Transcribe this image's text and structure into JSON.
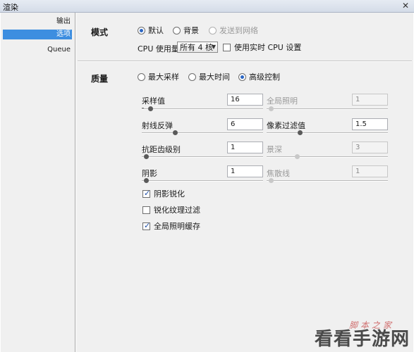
{
  "window": {
    "title": "渲染",
    "close_glyph": "✕"
  },
  "sidebar": {
    "items": [
      {
        "label": "输出",
        "selected": false
      },
      {
        "label": "选项",
        "selected": true
      },
      {
        "label": "Queue",
        "selected": false
      }
    ]
  },
  "mode": {
    "section_label": "模式",
    "options": [
      {
        "label": "默认",
        "selected": true,
        "enabled": true
      },
      {
        "label": "背景",
        "selected": false,
        "enabled": true
      },
      {
        "label": "发送到网络",
        "selected": false,
        "enabled": false
      }
    ],
    "cpu_label": "CPU 使用量",
    "cpu_value": "所有 4 核",
    "realtime_cpu_label": "使用实时 CPU 设置",
    "realtime_cpu_checked": false
  },
  "quality": {
    "section_label": "质量",
    "options": [
      {
        "label": "最大采样",
        "selected": false
      },
      {
        "label": "最大时间",
        "selected": false
      },
      {
        "label": "高级控制",
        "selected": true
      }
    ],
    "params": [
      {
        "label": "采样值",
        "value": "16",
        "enabled": true,
        "level": 0.05
      },
      {
        "label": "全局照明",
        "value": "1",
        "enabled": false,
        "level": 0.0
      },
      {
        "label": "射线反弹",
        "value": "6",
        "enabled": true,
        "level": 0.3
      },
      {
        "label": "像素过滤值",
        "value": "1.5",
        "enabled": true,
        "level": 0.3
      },
      {
        "label": "抗距齿级别",
        "value": "1",
        "enabled": true,
        "level": 0.0
      },
      {
        "label": "景深",
        "value": "3",
        "enabled": false,
        "level": 0.2
      },
      {
        "label": "阴影",
        "value": "1",
        "enabled": true,
        "level": 0.0
      },
      {
        "label": "焦散线",
        "value": "1",
        "enabled": false,
        "level": 0.0
      }
    ],
    "checkboxes": [
      {
        "label": "阴影锐化",
        "checked": true
      },
      {
        "label": "锐化纹理过滤",
        "checked": false
      },
      {
        "label": "全局照明缓存",
        "checked": true
      }
    ]
  },
  "watermark": {
    "text": "看看手游网",
    "small_text": "脚本之家"
  }
}
